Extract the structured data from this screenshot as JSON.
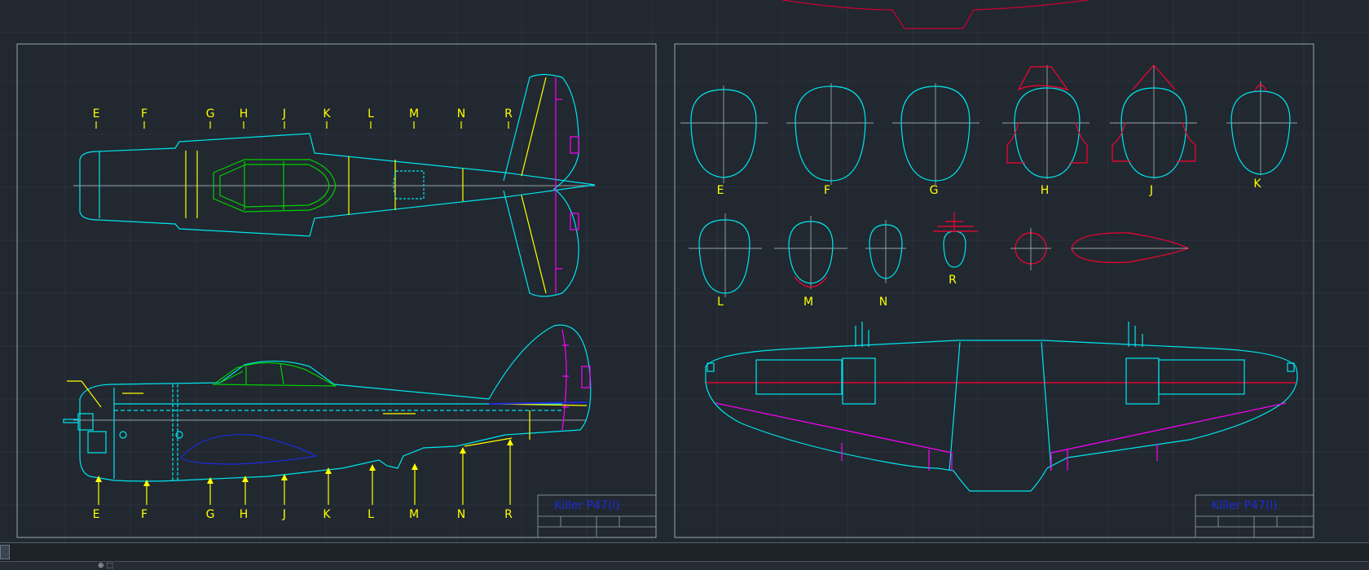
{
  "drawing": {
    "title_block_text": "Killer P47(l)",
    "section_labels": [
      "E",
      "F",
      "G",
      "H",
      "J",
      "K",
      "L",
      "M",
      "N",
      "R"
    ],
    "cross_section_labels": [
      "E",
      "F",
      "G",
      "H",
      "J",
      "K",
      "L",
      "M",
      "N",
      "R"
    ]
  },
  "colors": {
    "background": "#212830",
    "outline": "#00e5ee",
    "stations": "#ffff00",
    "canopy": "#00d000",
    "control": "#ff00ff",
    "datum": "#ff0033",
    "title_text": "#1e2bd8"
  },
  "status": {
    "icon": "crosshair-icon"
  }
}
